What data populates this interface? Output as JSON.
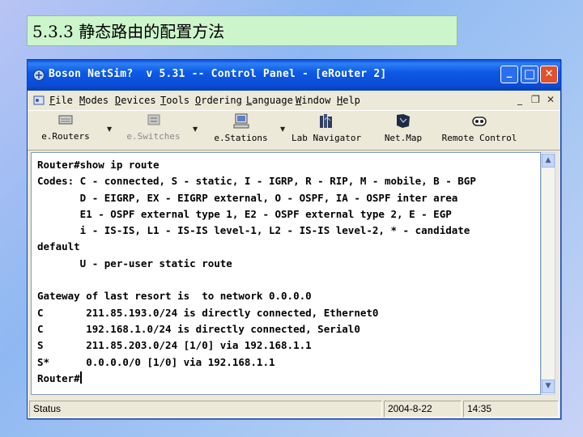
{
  "slide": {
    "title": "5.3.3 静态路由的配置方法"
  },
  "window": {
    "title": "Boson NetSim?  v 5.31 -- Control Panel - [eRouter 2]",
    "controls": {
      "minimize": "_",
      "maximize": "□",
      "close": "✕"
    }
  },
  "menu": {
    "items": [
      "File",
      "Modes",
      "Devices",
      "Tools",
      "Ordering",
      "Language",
      "Window",
      "Help"
    ],
    "mdi": {
      "minimize": "_",
      "restore": "❐",
      "close": "✕"
    }
  },
  "toolbar": {
    "buttons": [
      {
        "label": "e.Routers",
        "icon": "router-icon",
        "enabled": true
      },
      {
        "label": "e.Switches",
        "icon": "switch-icon",
        "enabled": false
      },
      {
        "label": "e.Stations",
        "icon": "station-icon",
        "enabled": true
      },
      {
        "label": "Lab Navigator",
        "icon": "lab-navigator-icon",
        "enabled": true
      },
      {
        "label": "Net.Map",
        "icon": "netmap-icon",
        "enabled": true
      },
      {
        "label": "Remote Control",
        "icon": "remote-control-icon",
        "enabled": true
      }
    ],
    "dropdown_arrow": "▼"
  },
  "console": {
    "lines": [
      "Router#show ip route",
      "Codes: C - connected, S - static, I - IGRP, R - RIP, M - mobile, B - BGP",
      "       D - EIGRP, EX - EIGRP external, O - OSPF, IA - OSPF inter area",
      "       E1 - OSPF external type 1, E2 - OSPF external type 2, E - EGP",
      "       i - IS-IS, L1 - IS-IS level-1, L2 - IS-IS level-2, * - candidate",
      "default",
      "       U - per-user static route",
      "",
      "Gateway of last resort is  to network 0.0.0.0",
      "C       211.85.193.0/24 is directly connected, Ethernet0",
      "C       192.168.1.0/24 is directly connected, Serial0",
      "S       211.85.203.0/24 [1/0] via 192.168.1.1",
      "S*      0.0.0.0/0 [1/0] via 192.168.1.1"
    ],
    "prompt": "Router#"
  },
  "scrollbar": {
    "up": "▲",
    "down": "▼"
  },
  "status": {
    "label": "Status",
    "date": "2004-8-22",
    "time": "14:35"
  },
  "colors": {
    "title_bar": "#0a4fd8",
    "slide_title_bg": "#ccf5cc",
    "window_bg": "#ece9d8",
    "close_button": "#e0522c"
  }
}
